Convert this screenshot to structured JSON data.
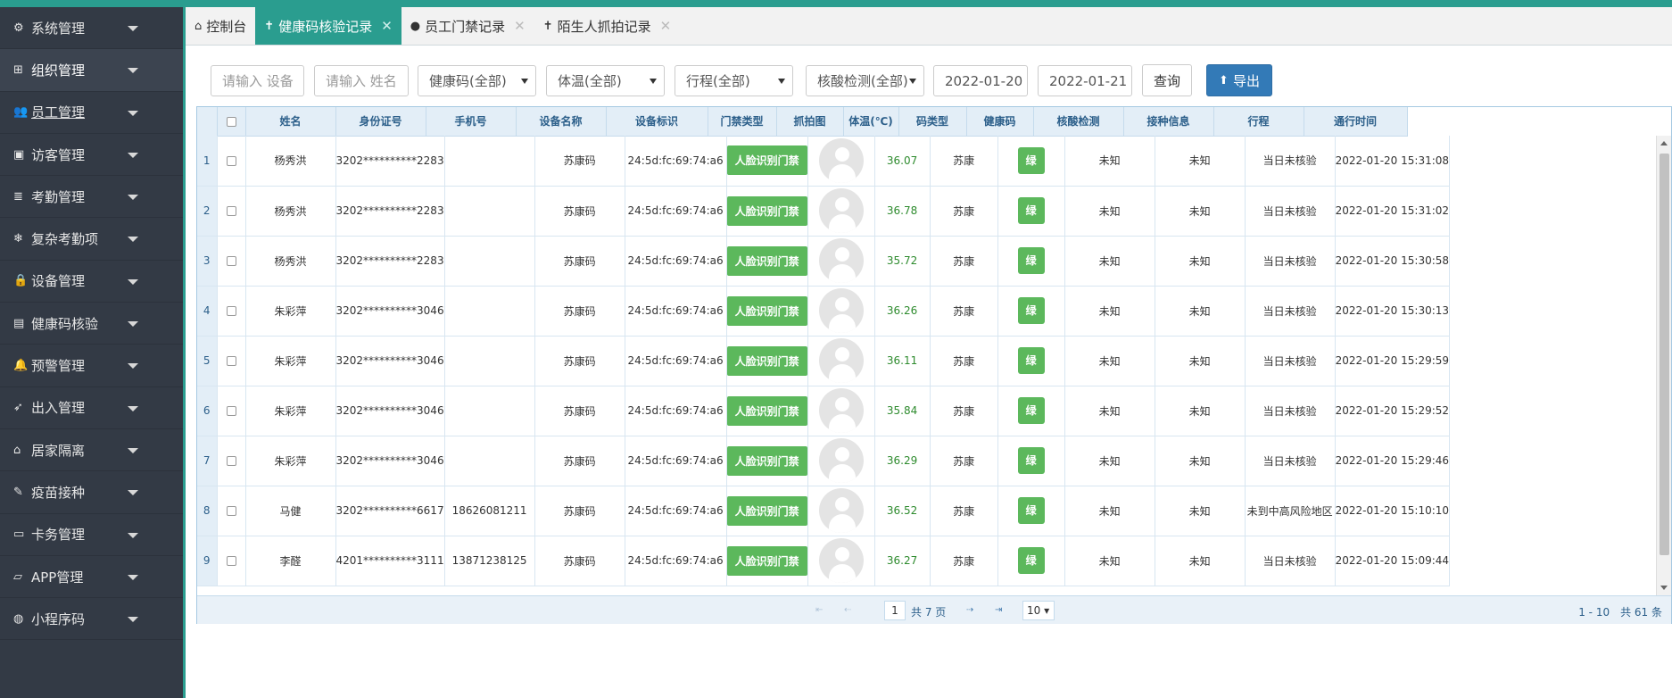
{
  "sidebar": {
    "items": [
      {
        "icon": "gear-icon",
        "glyph": "⚙",
        "label": "系统管理"
      },
      {
        "icon": "sitemap-icon",
        "glyph": "⊞",
        "label": "组织管理"
      },
      {
        "icon": "users-icon",
        "glyph": "👥",
        "label": "员工管理"
      },
      {
        "icon": "id-card-icon",
        "glyph": "▣",
        "label": "访客管理"
      },
      {
        "icon": "list-icon",
        "glyph": "≣",
        "label": "考勤管理"
      },
      {
        "icon": "snowflake-icon",
        "glyph": "❄",
        "label": "复杂考勤项"
      },
      {
        "icon": "lock-icon",
        "glyph": "🔒",
        "label": "设备管理"
      },
      {
        "icon": "save-icon",
        "glyph": "▤",
        "label": "健康码核验"
      },
      {
        "icon": "bell-icon",
        "glyph": "🔔",
        "label": "预警管理"
      },
      {
        "icon": "rocket-icon",
        "glyph": "➶",
        "label": "出入管理"
      },
      {
        "icon": "home-icon",
        "glyph": "⌂",
        "label": "居家隔离"
      },
      {
        "icon": "syringe-icon",
        "glyph": "✎",
        "label": "疫苗接种"
      },
      {
        "icon": "card-icon",
        "glyph": "▭",
        "label": "卡务管理"
      },
      {
        "icon": "laptop-icon",
        "glyph": "▱",
        "label": "APP管理"
      },
      {
        "icon": "wechat-icon",
        "glyph": "◍",
        "label": "小程序码"
      }
    ]
  },
  "tabs": [
    {
      "icon": "home-icon",
      "glyph": "⌂",
      "label": "控制台",
      "closable": false
    },
    {
      "icon": "user-icon",
      "glyph": "✝",
      "label": "健康码核验记录",
      "closable": true
    },
    {
      "icon": "user-icon",
      "glyph": "●",
      "label": "员工门禁记录",
      "closable": true
    },
    {
      "icon": "user-icon",
      "glyph": "✝",
      "label": "陌生人抓拍记录",
      "closable": true
    }
  ],
  "filters": {
    "device_placeholder": "请输入 设备",
    "name_placeholder": "请输入 姓名",
    "health_code": "健康码(全部)",
    "temperature": "体温(全部)",
    "itinerary": "行程(全部)",
    "nucleic": "核酸检测(全部)",
    "date_from": "2022-01-20",
    "date_to": "2022-01-21",
    "query_label": "查询",
    "export_label": "导出"
  },
  "table": {
    "columns": [
      "",
      "",
      "姓名",
      "身份证号",
      "手机号",
      "设备名称",
      "设备标识",
      "门禁类型",
      "抓拍图",
      "体温(℃)",
      "码类型",
      "健康码",
      "核酸检测",
      "接种信息",
      "行程",
      "通行时间"
    ],
    "rows": [
      {
        "n": "1",
        "name": "杨秀洪",
        "id": "3202**********2283",
        "phone": "",
        "device": "苏康码",
        "mac": "24:5d:fc:69:74:a6",
        "door": "人脸识别门禁",
        "temp": "36.07",
        "code_type": "苏康",
        "code": "绿",
        "nucleic": "未知",
        "vaccine": "未知",
        "trip": "当日未核验",
        "time": "2022-01-20 15:31:08"
      },
      {
        "n": "2",
        "name": "杨秀洪",
        "id": "3202**********2283",
        "phone": "",
        "device": "苏康码",
        "mac": "24:5d:fc:69:74:a6",
        "door": "人脸识别门禁",
        "temp": "36.78",
        "code_type": "苏康",
        "code": "绿",
        "nucleic": "未知",
        "vaccine": "未知",
        "trip": "当日未核验",
        "time": "2022-01-20 15:31:02"
      },
      {
        "n": "3",
        "name": "杨秀洪",
        "id": "3202**********2283",
        "phone": "",
        "device": "苏康码",
        "mac": "24:5d:fc:69:74:a6",
        "door": "人脸识别门禁",
        "temp": "35.72",
        "code_type": "苏康",
        "code": "绿",
        "nucleic": "未知",
        "vaccine": "未知",
        "trip": "当日未核验",
        "time": "2022-01-20 15:30:58"
      },
      {
        "n": "4",
        "name": "朱彩萍",
        "id": "3202**********3046",
        "phone": "",
        "device": "苏康码",
        "mac": "24:5d:fc:69:74:a6",
        "door": "人脸识别门禁",
        "temp": "36.26",
        "code_type": "苏康",
        "code": "绿",
        "nucleic": "未知",
        "vaccine": "未知",
        "trip": "当日未核验",
        "time": "2022-01-20 15:30:13"
      },
      {
        "n": "5",
        "name": "朱彩萍",
        "id": "3202**********3046",
        "phone": "",
        "device": "苏康码",
        "mac": "24:5d:fc:69:74:a6",
        "door": "人脸识别门禁",
        "temp": "36.11",
        "code_type": "苏康",
        "code": "绿",
        "nucleic": "未知",
        "vaccine": "未知",
        "trip": "当日未核验",
        "time": "2022-01-20 15:29:59"
      },
      {
        "n": "6",
        "name": "朱彩萍",
        "id": "3202**********3046",
        "phone": "",
        "device": "苏康码",
        "mac": "24:5d:fc:69:74:a6",
        "door": "人脸识别门禁",
        "temp": "35.84",
        "code_type": "苏康",
        "code": "绿",
        "nucleic": "未知",
        "vaccine": "未知",
        "trip": "当日未核验",
        "time": "2022-01-20 15:29:52"
      },
      {
        "n": "7",
        "name": "朱彩萍",
        "id": "3202**********3046",
        "phone": "",
        "device": "苏康码",
        "mac": "24:5d:fc:69:74:a6",
        "door": "人脸识别门禁",
        "temp": "36.29",
        "code_type": "苏康",
        "code": "绿",
        "nucleic": "未知",
        "vaccine": "未知",
        "trip": "当日未核验",
        "time": "2022-01-20 15:29:46"
      },
      {
        "n": "8",
        "name": "马健",
        "id": "3202**********6617",
        "phone": "18626081211",
        "device": "苏康码",
        "mac": "24:5d:fc:69:74:a6",
        "door": "人脸识别门禁",
        "temp": "36.52",
        "code_type": "苏康",
        "code": "绿",
        "nucleic": "未知",
        "vaccine": "未知",
        "trip": "未到中高风险地区",
        "time": "2022-01-20 15:10:10"
      },
      {
        "n": "9",
        "name": "李醛",
        "id": "4201**********3111",
        "phone": "13871238125",
        "device": "苏康码",
        "mac": "24:5d:fc:69:74:a6",
        "door": "人脸识别门禁",
        "temp": "36.27",
        "code_type": "苏康",
        "code": "绿",
        "nucleic": "未知",
        "vaccine": "未知",
        "trip": "当日未核验",
        "time": "2022-01-20 15:09:44"
      }
    ]
  },
  "pager": {
    "first": "⇤",
    "prev": "⇠",
    "page": "1",
    "total_pages": "共 7 页",
    "next": "⇢",
    "last": "⇥",
    "page_size": "10 ▾",
    "records": "1 - 10　共 61 条"
  },
  "colors": {
    "accent": "#2a9d8f",
    "sidebar": "#333a45",
    "green": "#5cb85c",
    "export": "#337ab7"
  }
}
